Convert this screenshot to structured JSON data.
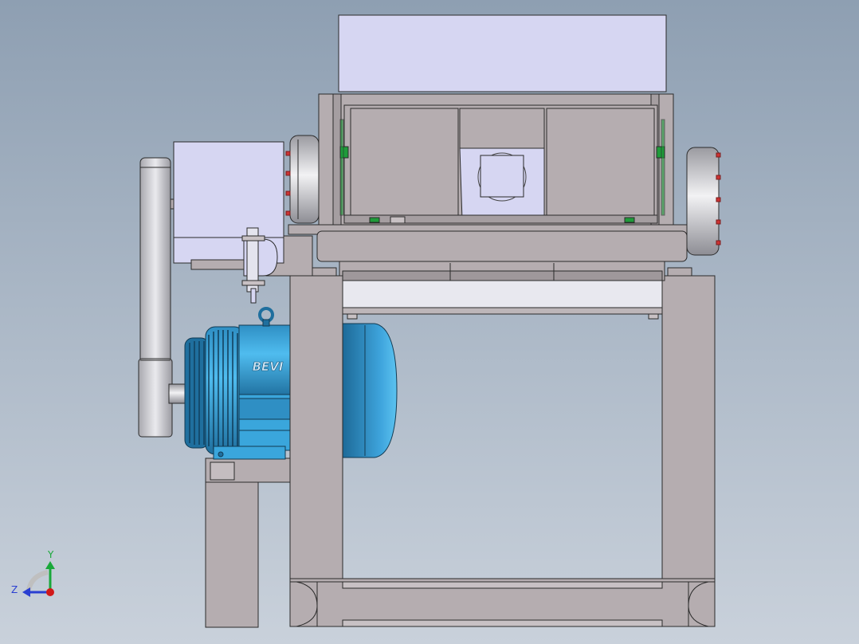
{
  "viewport": {
    "background_top": "#8e9fb2",
    "background_bottom": "#c9d1db"
  },
  "model": {
    "motor_brand_label": "BEVI",
    "colors": {
      "frame": "#b5adb0",
      "frame_edge": "#2a2a2a",
      "hopper": "#d6d6f2",
      "gearbox": "#d6d6f2",
      "motor": "#3aa6dc",
      "motor_dark": "#1f6f9e",
      "bearing": "#c8c8cc",
      "bolt": "#cc3333",
      "seal": "#1f9b3a"
    }
  },
  "triad": {
    "y_label": "Y",
    "z_label": "Z",
    "y_color": "#19a83a",
    "z_color": "#2a3fd1",
    "x_color": "#d11919"
  }
}
